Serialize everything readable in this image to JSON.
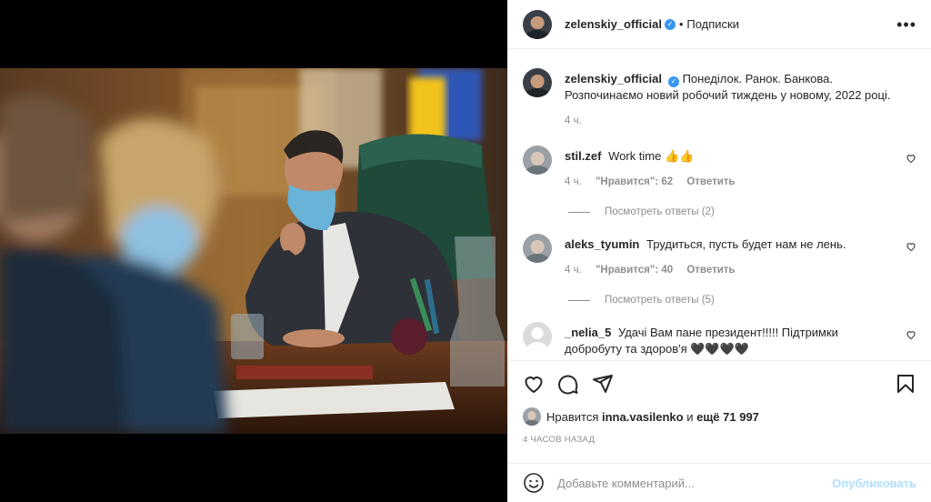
{
  "post": {
    "author": "zelenskiy_official",
    "follow_status": "Подписки",
    "separator": "•",
    "more_icon": "more-horizontal-icon",
    "caption_line1": "Понеділок. Ранок. Банкова.",
    "caption_line2": "Розпочинаємо новий робочий тиждень у новому, 2022 році.",
    "caption_age": "4 ч."
  },
  "comments": [
    {
      "user": "stil.zef",
      "text": "Work time 👍👍",
      "age": "4 ч.",
      "likes": "\"Нравится\": 62",
      "reply": "Ответить",
      "view_replies": "Посмотреть ответы (2)"
    },
    {
      "user": "aleks_tyumin",
      "text": "Трудиться, пусть будет нам не лень.",
      "age": "4 ч.",
      "likes": "\"Нравится\": 40",
      "reply": "Ответить",
      "view_replies": "Посмотреть ответы (5)"
    },
    {
      "user": "_nelia_5",
      "text": "Удачі Вам пане президент!!!!! Підтримки добробуту та здоров'я 🖤🖤🖤🖤"
    }
  ],
  "likes": {
    "prefix": "Нравится",
    "user": "inna.vasilenko",
    "middle": "и",
    "count": "ещё 71 997"
  },
  "timestamp": "4 ЧАСОВ НАЗАД",
  "comment_box": {
    "placeholder": "Добавьте комментарий...",
    "publish": "Опубликовать"
  },
  "colors": {
    "verified": "#3897f0",
    "publish_disabled": "#b2dffc",
    "meta": "#8e8e8e"
  }
}
